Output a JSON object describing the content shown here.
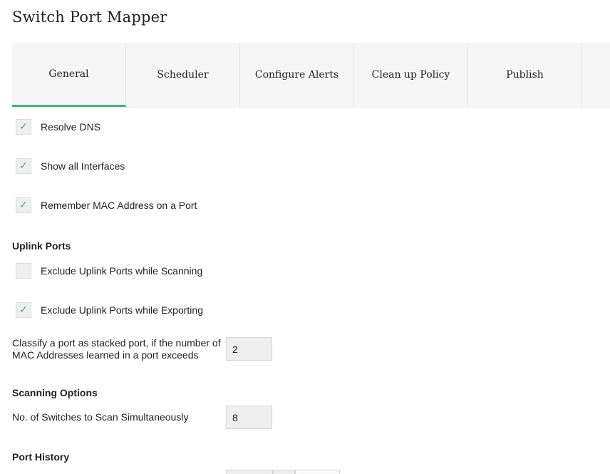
{
  "page": {
    "title": "Switch Port Mapper"
  },
  "tabs": [
    {
      "label": "General",
      "active": true
    },
    {
      "label": "Scheduler",
      "active": false
    },
    {
      "label": "Configure Alerts",
      "active": false
    },
    {
      "label": "Clean up Policy",
      "active": false
    },
    {
      "label": "Publish",
      "active": false
    }
  ],
  "general": {
    "resolve_dns": {
      "label": "Resolve DNS",
      "checked": true
    },
    "show_all_interfaces": {
      "label": "Show all Interfaces",
      "checked": true
    },
    "remember_mac": {
      "label": "Remember MAC Address on a Port",
      "checked": true
    }
  },
  "uplink": {
    "title": "Uplink Ports",
    "exclude_scanning": {
      "label": "Exclude Uplink Ports while Scanning",
      "checked": false
    },
    "exclude_exporting": {
      "label": "Exclude Uplink Ports while Exporting",
      "checked": true
    },
    "stacked_label_line1": "Classify a port as stacked port, if the number of",
    "stacked_label_line2": "MAC Addresses learned in a port exceeds",
    "stacked_value": "2"
  },
  "scanning": {
    "title": "Scanning Options",
    "switches_label": "No. of Switches to Scan Simultaneously",
    "switches_value": "8"
  },
  "port_history": {
    "title": "Port History"
  },
  "checkmark_glyph": "✓",
  "accent_color": "#3eb37b"
}
